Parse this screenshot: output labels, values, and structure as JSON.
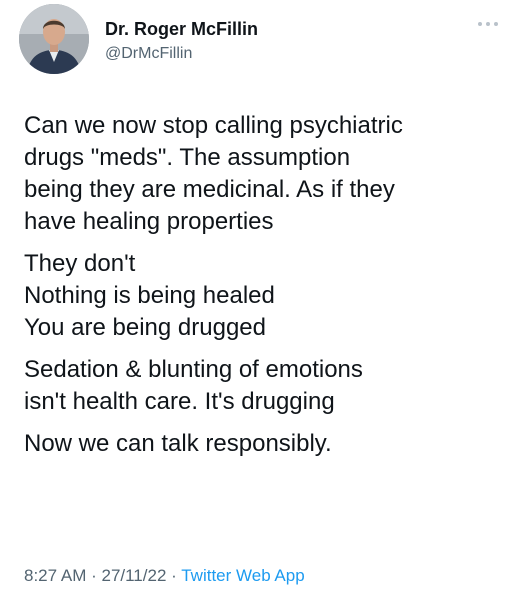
{
  "author": {
    "display_name": "Dr. Roger McFillin",
    "handle": "@DrMcFillin",
    "avatar_icon": "profile-photo",
    "more_icon": "more-options-icon"
  },
  "tweet": {
    "paragraphs": [
      {
        "lines": [
          "Can we now stop calling psychiatric",
          "drugs \"meds\". The assumption",
          "being they are medicinal. As if they",
          "have healing properties"
        ]
      },
      {
        "lines": [
          "They don't",
          "Nothing is being healed",
          "You are being drugged"
        ]
      },
      {
        "lines": [
          "Sedation & blunting of emotions",
          "isn't health care. It's drugging"
        ]
      },
      {
        "lines": [
          "Now we can talk responsibly."
        ]
      }
    ]
  },
  "meta": {
    "time": "8:27 AM",
    "separator": " · ",
    "date": "27/11/22",
    "source": "Twitter Web App"
  },
  "colors": {
    "text": "#0f1419",
    "secondary": "#536471",
    "link": "#1d9bf0"
  }
}
